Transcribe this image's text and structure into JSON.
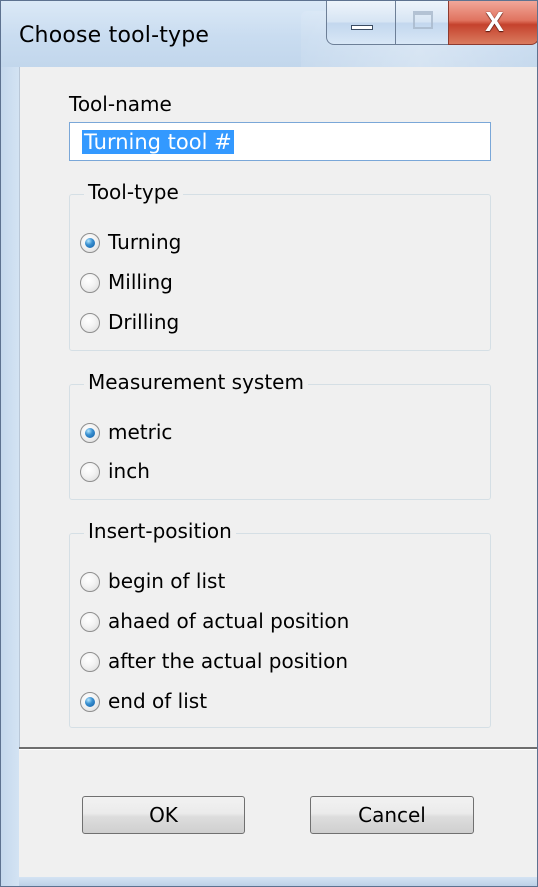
{
  "window": {
    "title": "Choose tool-type"
  },
  "caption_buttons": {
    "minimize_icon": "minimize-icon",
    "maximize_icon": "maximize-icon",
    "close_label": "X"
  },
  "tool_name": {
    "label": "Tool-name",
    "value": "Turning tool #"
  },
  "tool_type": {
    "title": "Tool-type",
    "options": [
      {
        "label": "Turning",
        "checked": true
      },
      {
        "label": "Milling",
        "checked": false
      },
      {
        "label": "Drilling",
        "checked": false
      }
    ]
  },
  "measurement_system": {
    "title": "Measurement system",
    "options": [
      {
        "label": "metric",
        "checked": true
      },
      {
        "label": "inch",
        "checked": false
      }
    ]
  },
  "insert_position": {
    "title": "Insert-position",
    "options": [
      {
        "label": "begin of list",
        "checked": false
      },
      {
        "label": "ahaed of actual position",
        "checked": false
      },
      {
        "label": "after the actual position",
        "checked": false
      },
      {
        "label": "end of list",
        "checked": true
      }
    ]
  },
  "buttons": {
    "ok": "OK",
    "cancel": "Cancel"
  }
}
